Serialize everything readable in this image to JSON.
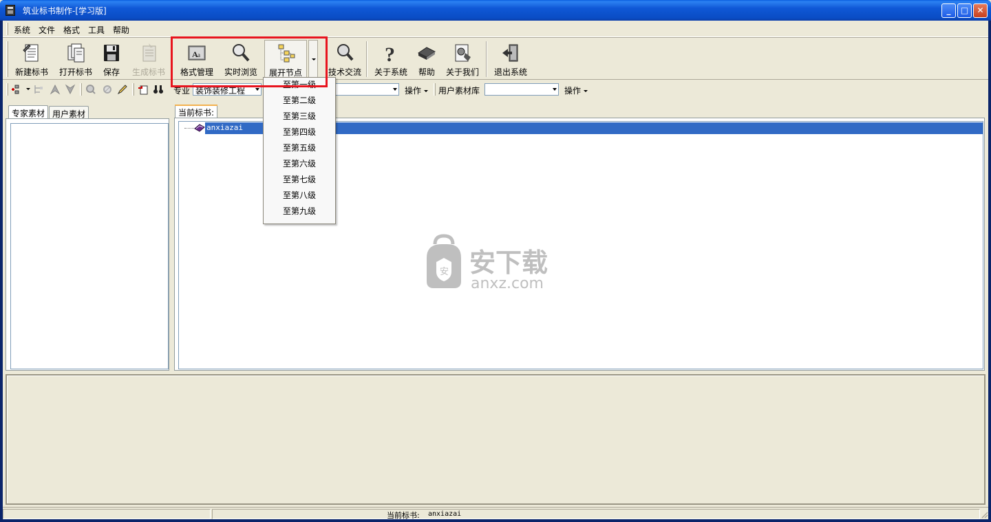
{
  "window": {
    "title": "筑业标书制作-[学习版]",
    "controls": {
      "minimize": "_",
      "maximize": "□",
      "close": "✕"
    }
  },
  "menu": [
    "系统",
    "文件",
    "格式",
    "工具",
    "帮助"
  ],
  "toolbar": {
    "new": "新建标书",
    "open": "打开标书",
    "save": "保存",
    "generate": "生成标书",
    "format": "格式管理",
    "preview": "实时浏览",
    "expand": "展开节点",
    "tech": "技术交流",
    "about_system": "关于系统",
    "help": "帮助",
    "about_us": "关于我们",
    "exit": "退出系统"
  },
  "toolbar2": {
    "specialty_label": "专业",
    "specialty_value": "装饰装修工程",
    "operate1": "操作",
    "user_lib_label": "用户素材库",
    "operate2": "操作"
  },
  "left_tabs": [
    "专家素材",
    "用户素材"
  ],
  "right_tab": "当前标书:",
  "tree": {
    "root": "anxiazai"
  },
  "dropdown_items": [
    "至第一级",
    "至第二级",
    "至第三级",
    "至第四级",
    "至第五级",
    "至第六级",
    "至第七级",
    "至第八级",
    "至第九级"
  ],
  "status": {
    "label": "当前标书:",
    "value": "anxiazai"
  },
  "watermark": {
    "cn": "安下载",
    "en": "anxz.com"
  },
  "colors": {
    "selection": "#316AC5",
    "highlight_box": "#E8141E",
    "title_bar": "#0A4CC4"
  }
}
